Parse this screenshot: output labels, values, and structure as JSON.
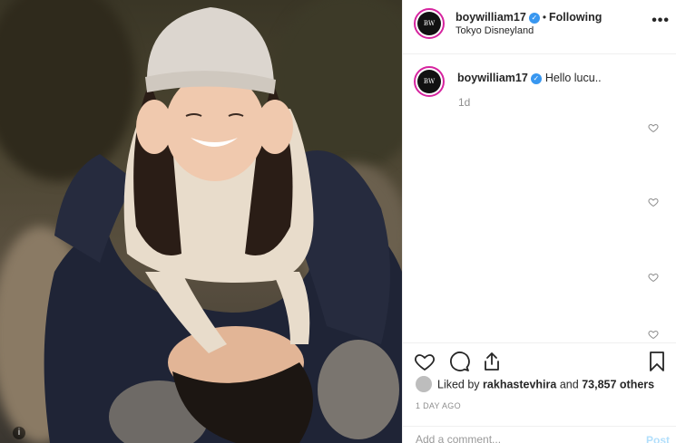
{
  "post": {
    "username": "boywilliam17",
    "follow_status": "Following",
    "location": "Tokyo Disneyland",
    "more_icon": "more-icon",
    "avatar_text": "BW"
  },
  "caption": {
    "username": "boywilliam17",
    "text": "Hello lucu..",
    "time": "1d"
  },
  "likes": {
    "prefix": "Liked by",
    "user": "rakhastevhira",
    "conjunction": "and",
    "others": "73,857 others"
  },
  "timestamp": "1 DAY AGO",
  "comment_box": {
    "placeholder": "Add a comment...",
    "post_label": "Post"
  },
  "photo": {
    "indicator": "i"
  },
  "colors": {
    "verified": "#3897f0",
    "avatar_ring": "#d6249f",
    "post_button": "#b2dffc"
  }
}
